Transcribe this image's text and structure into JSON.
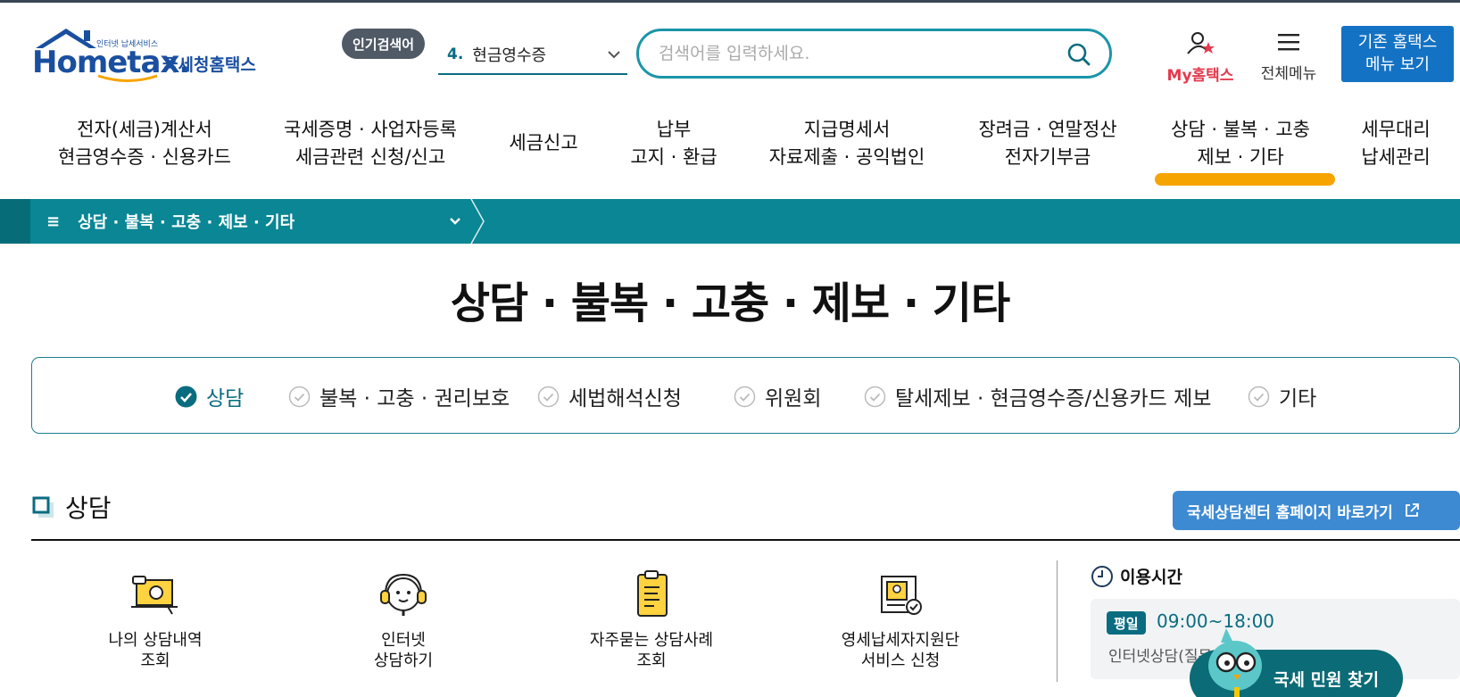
{
  "header": {
    "logo": {
      "tagline": "인터넷 납세서비스",
      "wordmark": "Hometax.",
      "korean": "국세청홈택스"
    },
    "popular": {
      "badge": "인기검색어",
      "rank": "4.",
      "term": "현금영수증"
    },
    "search": {
      "placeholder": "검색어를 입력하세요."
    },
    "my_label": "My홈택스",
    "menu_label": "전체메뉴",
    "old_menu": {
      "line1": "기존 홈택스",
      "line2": "메뉴 보기"
    }
  },
  "gnb": [
    {
      "line1": "전자(세금)계산서",
      "line2": "현금영수증 · 신용카드"
    },
    {
      "line1": "국세증명 · 사업자등록",
      "line2": "세금관련 신청/신고"
    },
    {
      "line1": "세금신고",
      "line2": ""
    },
    {
      "line1": "납부",
      "line2": "고지 · 환급"
    },
    {
      "line1": "지급명세서",
      "line2": "자료제출 · 공익법인"
    },
    {
      "line1": "장려금 · 연말정산",
      "line2": "전자기부금"
    },
    {
      "line1": "상담 · 불복 · 고충",
      "line2": "제보 · 기타"
    },
    {
      "line1": "세무대리",
      "line2": "납세관리"
    }
  ],
  "breadcrumb": {
    "label": "상담 · 불복 · 고충 · 제보 · 기타"
  },
  "page_title": "상담 · 불복 · 고충 · 제보 · 기타",
  "tabs": [
    {
      "label": "상담",
      "active": true
    },
    {
      "label": "불복 · 고충 · 권리보호",
      "active": false
    },
    {
      "label": "세법해석신청",
      "active": false
    },
    {
      "label": "위원회",
      "active": false
    },
    {
      "label": "탈세제보 · 현금영수증/신용카드 제보",
      "active": false
    },
    {
      "label": "기타",
      "active": false
    }
  ],
  "section": {
    "title": "상담",
    "link": "국세상담센터 홈페이지 바로가기",
    "services": [
      {
        "line1": "나의 상담내역",
        "line2": "조회",
        "icon": "monitor-icon"
      },
      {
        "line1": "인터넷",
        "line2": "상담하기",
        "icon": "headset-icon"
      },
      {
        "line1": "자주묻는 상담사례",
        "line2": "조회",
        "icon": "document-icon"
      },
      {
        "line1": "영세납세자지원단",
        "line2": "서비스 신청",
        "icon": "certificate-icon"
      }
    ],
    "hours": {
      "title": "이용시간",
      "badge": "평일",
      "time": "09:00~18:00",
      "note": "인터넷상담(질문"
    }
  },
  "floating": {
    "label": "국세 민원 찾기"
  },
  "colors": {
    "teal": "#0a8694",
    "accent": "#f6a400",
    "brand_blue": "#1472c4",
    "link_blue": "#3d8ad2"
  }
}
